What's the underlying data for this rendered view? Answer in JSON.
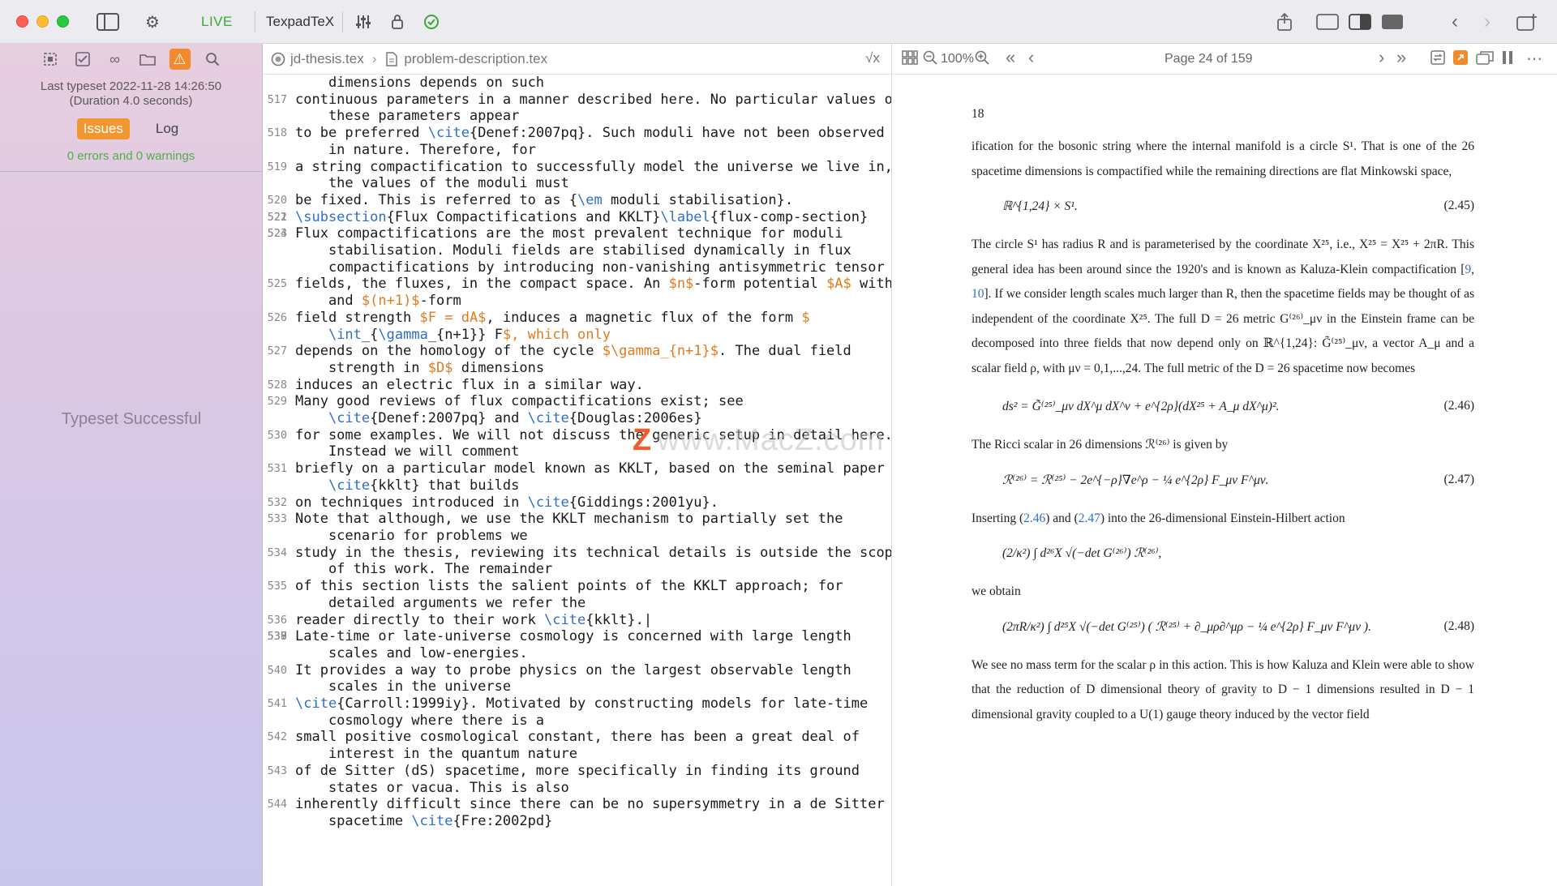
{
  "titlebar": {
    "live_label": "LIVE",
    "engine_label": "TexpadTeX"
  },
  "sidebar": {
    "last_typeset": "Last typeset 2022-11-28 14:26:50",
    "duration": "(Duration 4.0 seconds)",
    "tabs": [
      {
        "label": "Issues"
      },
      {
        "label": "Log"
      }
    ],
    "error_summary": "0 errors and 0 warnings",
    "typeset_status": "Typeset Successful"
  },
  "editor": {
    "breadcrumbs": [
      "jd-thesis.tex",
      "problem-description.tex"
    ],
    "lines": [
      {
        "n": "",
        "t": "    dimensions depends on such"
      },
      {
        "n": "517",
        "t": "continuous parameters in a manner described here. No particular values of"
      },
      {
        "n": "",
        "t": "    these parameters appear"
      },
      {
        "n": "518",
        "t": "to be preferred \\cite{Denef:2007pq}. Such moduli have not been observed"
      },
      {
        "n": "",
        "t": "    in nature. Therefore, for"
      },
      {
        "n": "519",
        "t": "a string compactification to successfully model the universe we live in,"
      },
      {
        "n": "",
        "t": "    the values of the moduli must"
      },
      {
        "n": "520",
        "t": "be fixed. This is referred to as {\\em moduli stabilisation}."
      },
      {
        "n": "521",
        "t": ""
      },
      {
        "n": "522",
        "t": "\\subsection{Flux Compactifications and KKLT}\\label{flux-comp-section}"
      },
      {
        "n": "523",
        "t": ""
      },
      {
        "n": "524",
        "t": "Flux compactifications are the most prevalent technique for moduli"
      },
      {
        "n": "",
        "t": "    stabilisation. Moduli fields are stabilised dynamically in flux"
      },
      {
        "n": "",
        "t": "    compactifications by introducing non-vanishing antisymmetric tensor"
      },
      {
        "n": "525",
        "t": "fields, the fluxes, in the compact space. An $n$-form potential $A$ with"
      },
      {
        "n": "",
        "t": "    and $(n+1)$-form"
      },
      {
        "n": "526",
        "t": "field strength $F = dA$, induces a magnetic flux of the form $"
      },
      {
        "n": "",
        "t": "    \\int_{\\gamma_{n+1}} F$, which only"
      },
      {
        "n": "527",
        "t": "depends on the homology of the cycle $\\gamma_{n+1}$. The dual field"
      },
      {
        "n": "",
        "t": "    strength in $D$ dimensions"
      },
      {
        "n": "528",
        "t": "induces an electric flux in a similar way."
      },
      {
        "n": "529",
        "t": "Many good reviews of flux compactifications exist; see"
      },
      {
        "n": "",
        "t": "    \\cite{Denef:2007pq} and \\cite{Douglas:2006es}"
      },
      {
        "n": "530",
        "t": "for some examples. We will not discuss the generic setup in detail here."
      },
      {
        "n": "",
        "t": "    Instead we will comment"
      },
      {
        "n": "531",
        "t": "briefly on a particular model known as KKLT, based on the seminal paper"
      },
      {
        "n": "",
        "t": "    \\cite{kklt} that builds"
      },
      {
        "n": "532",
        "t": "on techniques introduced in \\cite{Giddings:2001yu}."
      },
      {
        "n": "533",
        "t": "Note that although, we use the KKLT mechanism to partially set the"
      },
      {
        "n": "",
        "t": "    scenario for problems we"
      },
      {
        "n": "534",
        "t": "study in the thesis, reviewing its technical details is outside the scope"
      },
      {
        "n": "",
        "t": "    of this work. The remainder"
      },
      {
        "n": "535",
        "t": "of this section lists the salient points of the KKLT approach; for"
      },
      {
        "n": "",
        "t": "    detailed arguments we refer the"
      },
      {
        "n": "536",
        "t": "reader directly to their work \\cite{kklt}.|"
      },
      {
        "n": "537",
        "t": ""
      },
      {
        "n": "538",
        "t": ""
      },
      {
        "n": "539",
        "t": "Late-time or late-universe cosmology is concerned with large length"
      },
      {
        "n": "",
        "t": "    scales and low-energies."
      },
      {
        "n": "540",
        "t": "It provides a way to probe physics on the largest observable length"
      },
      {
        "n": "",
        "t": "    scales in the universe"
      },
      {
        "n": "541",
        "t": "\\cite{Carroll:1999iy}. Motivated by constructing models for late-time"
      },
      {
        "n": "",
        "t": "    cosmology where there is a"
      },
      {
        "n": "542",
        "t": "small positive cosmological constant, there has been a great deal of"
      },
      {
        "n": "",
        "t": "    interest in the quantum nature"
      },
      {
        "n": "543",
        "t": "of de Sitter (dS) spacetime, more specifically in finding its ground"
      },
      {
        "n": "",
        "t": "    states or vacua. This is also"
      },
      {
        "n": "544",
        "t": "inherently difficult since there can be no supersymmetry in a de Sitter"
      },
      {
        "n": "",
        "t": "    spacetime \\cite{Fre:2002pd}"
      }
    ]
  },
  "pdf": {
    "zoom": "100%",
    "page_indicator": "Page 24 of 159",
    "page_number": "18",
    "p1": "ification for the bosonic string where the internal manifold is a circle S¹. That is one of the 26 spacetime dimensions is compactified while the remaining directions are flat Minkowski space,",
    "eq245": "ℝ^{1,24} × S¹.",
    "eq245_num": "(2.45)",
    "p2_a": "The circle S¹ has radius R and is parameterised by the coordinate X²⁵, i.e., X²⁵ = X²⁵ + 2πR. This general idea has been around since the 1920's and is known as Kaluza-Klein compactification [",
    "ref9": "9",
    "ref10": "10",
    "p2_b": "]. If we consider length scales much larger than R, then the spacetime fields may be thought of as independent of the coordinate X²⁵. The full D = 26 metric G⁽²⁶⁾_μν in the Einstein frame can be decomposed into three fields that now depend only on ℝ^{1,24}: G̃⁽²⁵⁾_μν, a vector A_μ and a scalar field ρ, with μν = 0,1,...,24. The full metric of the D = 26 spacetime now becomes",
    "eq246": "ds² = G̃⁽²⁵⁾_μν dX^μ dX^ν + e^{2ρ}(dX²⁵ + A_μ dX^μ)².",
    "eq246_num": "(2.46)",
    "p3": "The Ricci scalar in 26 dimensions ℛ⁽²⁶⁾ is given by",
    "eq247": "ℛ⁽²⁶⁾ = ℛ⁽²⁵⁾ − 2e^{−ρ}∇e^ρ − ¼ e^{2ρ} F_μν F^μν.",
    "eq247_num": "(2.47)",
    "p4_a": "Inserting (",
    "ref246": "2.46",
    "p4_b": ") and (",
    "ref247": "2.47",
    "p4_c": ") into the 26-dimensional Einstein-Hilbert action",
    "eq_action": "(2/κ²) ∫ d²⁶X √(−det G⁽²⁶⁾) ℛ⁽²⁶⁾,",
    "p5": "we obtain",
    "eq248": "(2πR/κ²) ∫ d²⁵X √(−det G⁽²⁵⁾) ( ℛ⁽²⁵⁾ + ∂_μρ∂^μρ − ¼ e^{2ρ} F_μν F^μν ).",
    "eq248_num": "(2.48)",
    "p6": "We see no mass term for the scalar ρ in this action. This is how Kaluza and Klein were able to show that the reduction of D dimensional theory of gravity to D − 1 dimensions resulted in D − 1 dimensional gravity coupled to a U(1) gauge theory induced by the vector field"
  },
  "watermark": "www.MacZ.com",
  "icons": [
    "sidebar-toggle-icon",
    "gear-icon",
    "sliders-icon",
    "lock-icon",
    "check-circle-icon",
    "share-icon",
    "layout-left-icon",
    "layout-split-icon",
    "layout-right-icon",
    "back-icon",
    "forward-icon",
    "new-window-icon",
    "outline-icon",
    "checklist-icon",
    "infinity-icon",
    "folder-icon",
    "warning-icon",
    "search-icon",
    "sqrt-icon",
    "grid-icon",
    "zoom-out-icon",
    "zoom-in-icon",
    "first-page-icon",
    "prev-page-icon",
    "next-page-icon",
    "last-page-icon",
    "sync-icon",
    "open-external-icon",
    "windows-icon",
    "pause-icon",
    "more-icon"
  ]
}
